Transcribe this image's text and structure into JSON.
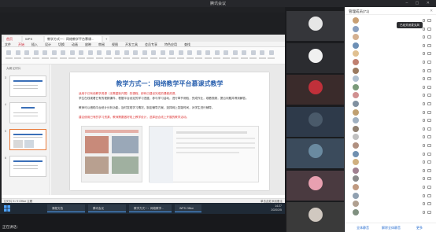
{
  "window": {
    "title": "腾讯会议"
  },
  "meetbar": {
    "left": "",
    "right": ""
  },
  "share": {
    "tabs": [
      "首页",
      "WPS",
      "教学方式一：网络教学平台慕课...",
      "+"
    ],
    "menus": [
      "文件",
      "开始",
      "插入",
      "设计",
      "切换",
      "动画",
      "放映",
      "审阅",
      "视图",
      "开发工具",
      "会员专享",
      "特色应用",
      "查找"
    ],
    "slide": {
      "title": "教学方式一：网络教学平台慕课式教学",
      "lines": [
        "适用于已有线教学资源（无需重新开展）的课程，即有已建设完成的课程资源。",
        "学生在线观看已有的视频课件，根据平台设定的学习进度，参与学习活动，进行章节测验，完成作业，观看视频，提出问题并得到解答。",
        "教师可以借助平台统计分析功能，及时发现学习情况，制定辅导方案，选择网上答疑时间，对学生进行辅导。"
      ],
      "line_red": "建议使用已有的学习资源，教师需要做好线上教学设计，选择适合线上开展的教学活动。"
    },
    "sidepane_tabs": "大纲  幻灯片",
    "thumbs": [
      "3",
      "4",
      "5",
      "6"
    ],
    "status": {
      "left": "幻灯片 5 / 9    Office 主题",
      "right": "单击此处添加备注"
    }
  },
  "taskbar": {
    "apps": [
      "课程文档",
      "腾讯会议",
      "教学方式一：网络教学...",
      "WPS Office"
    ],
    "time": "14:27",
    "date": "2020/2/5"
  },
  "bottombar": {
    "who": "正在讲话："
  },
  "videos": [
    {
      "name": "",
      "kind": "dog",
      "color": "#35363a"
    },
    {
      "name": "",
      "kind": "cat",
      "color": "#2b2c30"
    },
    {
      "name": "",
      "kind": "rose",
      "color": "#3a2b2b"
    },
    {
      "name": "",
      "kind": "car",
      "color": "#2e3a4a"
    },
    {
      "name": "",
      "kind": "lake",
      "color": "#3b4b5c"
    },
    {
      "name": "",
      "kind": "pink",
      "color": "#4a3a40"
    },
    {
      "name": "",
      "kind": "kitten",
      "color": "#3a3a3a"
    }
  ],
  "panel": {
    "title": "管理成员(71)",
    "tooltip": "已经关闭麦克风",
    "members": [
      {
        "name": "",
        "sub": "",
        "color": "#c9a074"
      },
      {
        "name": "",
        "sub": "",
        "color": "#8aa0c0"
      },
      {
        "name": "",
        "sub": "",
        "color": "#d4b090"
      },
      {
        "name": "",
        "sub": "",
        "color": "#6d8fb5"
      },
      {
        "name": "",
        "sub": "",
        "color": "#e0c090"
      },
      {
        "name": "",
        "sub": "",
        "color": "#c08070"
      },
      {
        "name": "",
        "sub": "",
        "color": "#9a7a60"
      },
      {
        "name": "",
        "sub": "",
        "color": "#b0c0d0"
      },
      {
        "name": "",
        "sub": "",
        "color": "#7a9a7a"
      },
      {
        "name": "",
        "sub": "",
        "color": "#d09090"
      },
      {
        "name": "",
        "sub": "",
        "color": "#8090a0"
      },
      {
        "name": "",
        "sub": "",
        "color": "#c0a070"
      },
      {
        "name": "",
        "sub": "",
        "color": "#a0b0c0"
      },
      {
        "name": "",
        "sub": "",
        "color": "#908070"
      },
      {
        "name": "",
        "sub": "",
        "color": "#c0c0c0"
      },
      {
        "name": "",
        "sub": "",
        "color": "#b09080"
      },
      {
        "name": "",
        "sub": "",
        "color": "#7090b0"
      },
      {
        "name": "",
        "sub": "",
        "color": "#d0b080"
      },
      {
        "name": "",
        "sub": "",
        "color": "#a08090"
      },
      {
        "name": "",
        "sub": "",
        "color": "#8a8a8a"
      },
      {
        "name": "",
        "sub": "",
        "color": "#c09a80"
      },
      {
        "name": "",
        "sub": "",
        "color": "#90a0b0"
      },
      {
        "name": "",
        "sub": "",
        "color": "#b0a090"
      },
      {
        "name": "",
        "sub": "",
        "color": "#809080"
      }
    ],
    "footer": [
      "全体静音",
      "解除全体静音",
      "更多"
    ]
  }
}
